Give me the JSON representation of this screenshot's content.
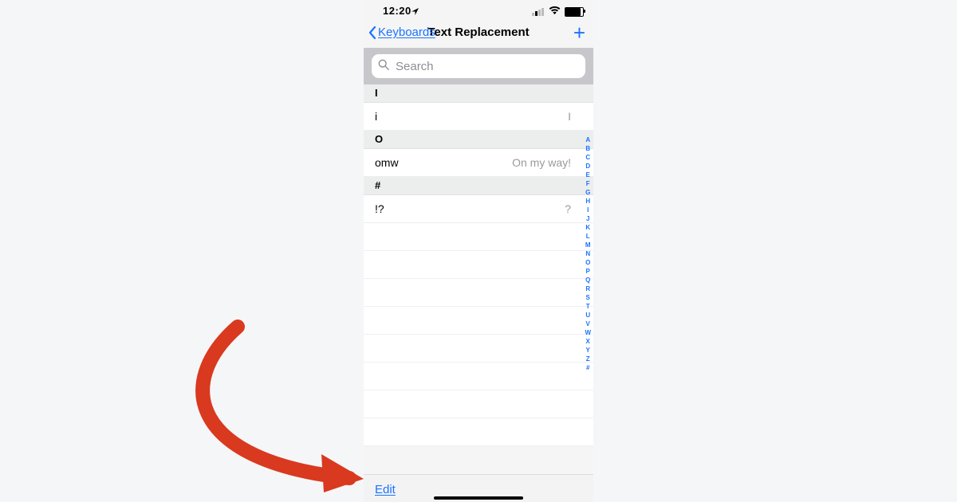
{
  "status": {
    "time": "12:20"
  },
  "nav": {
    "back": "Keyboards",
    "title": "Text Replacement"
  },
  "search": {
    "placeholder": "Search"
  },
  "sections": [
    {
      "head": "I",
      "rows": [
        {
          "k": "i",
          "v": "I"
        }
      ]
    },
    {
      "head": "O",
      "rows": [
        {
          "k": "omw",
          "v": "On my way!"
        }
      ]
    },
    {
      "head": "#",
      "rows": [
        {
          "k": "!?",
          "v": "?"
        }
      ]
    }
  ],
  "index": [
    "A",
    "B",
    "C",
    "D",
    "E",
    "F",
    "G",
    "H",
    "I",
    "J",
    "K",
    "L",
    "M",
    "N",
    "O",
    "P",
    "Q",
    "R",
    "S",
    "T",
    "U",
    "V",
    "W",
    "X",
    "Y",
    "Z",
    "#"
  ],
  "toolbar": {
    "edit": "Edit"
  }
}
